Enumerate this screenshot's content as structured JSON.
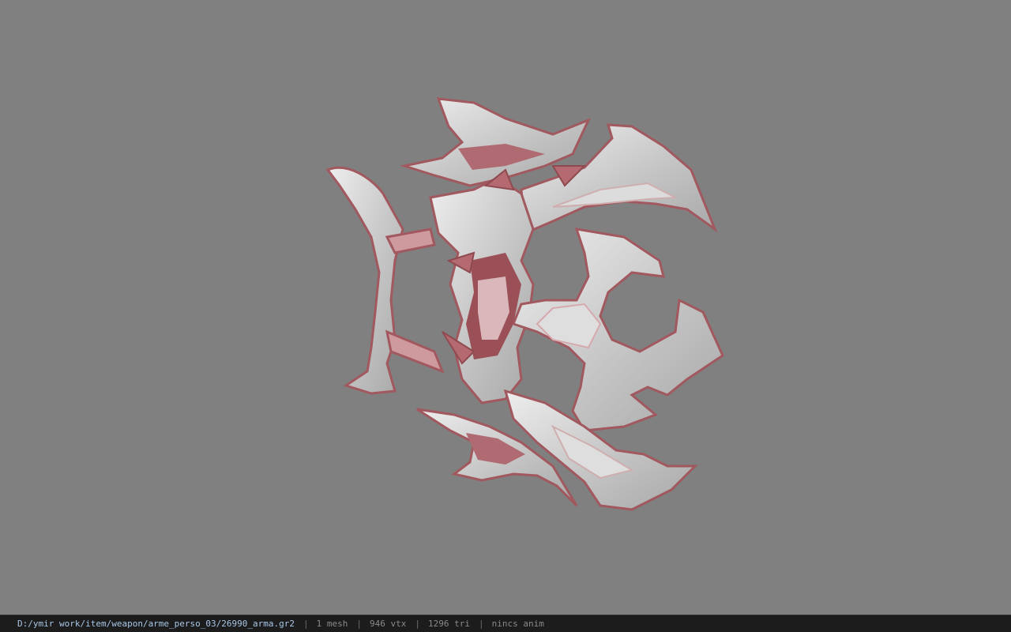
{
  "viewer": {
    "background_color": "#808080",
    "model_icon": "ornate-weapon-model",
    "model_colors": {
      "base": "#c9c9c9",
      "accent": "#a1585e",
      "highlight": "#f2f2f2"
    }
  },
  "status": {
    "file_path": "D:/ymir work/item/weapon/arme_perso_03/26990_arma.gr2",
    "separator": "|",
    "mesh_count": "1 mesh",
    "vertex_count": "946 vtx",
    "triangle_count": "1296 tri",
    "anim_status": "nincs anim"
  }
}
